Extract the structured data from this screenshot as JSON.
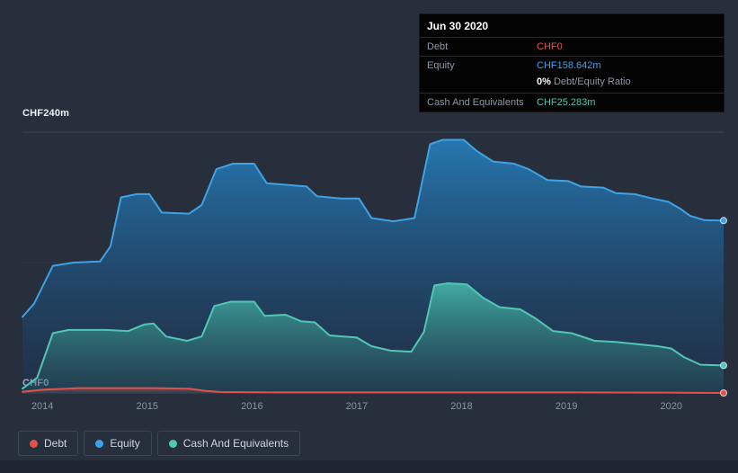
{
  "colors": {
    "background": "#272f3d",
    "grid": "#3c4554",
    "debt": "#e0524a",
    "equity": "#3ea2e5",
    "cash": "#52c6b4",
    "tooltip_background": "#040404",
    "tooltip_divider": "#2b2b2b",
    "muted_text": "#8d98a6",
    "axis_text": "#8a96a5"
  },
  "tooltip": {
    "title": "Jun 30 2020",
    "debt_label": "Debt",
    "debt_value": "CHF0",
    "equity_label": "Equity",
    "equity_value": "CHF158.642m",
    "ratio_value": "0%",
    "ratio_label": " Debt/Equity Ratio",
    "cash_label": "Cash And Equivalents",
    "cash_value": "CHF25.283m"
  },
  "axis": {
    "y_top": "CHF240m",
    "y_bottom": "CHF0"
  },
  "legend": {
    "items": [
      {
        "label": "Debt",
        "color": "#e0524a"
      },
      {
        "label": "Equity",
        "color": "#3ea2e5"
      },
      {
        "label": "Cash And Equivalents",
        "color": "#52c6b4"
      }
    ]
  },
  "chart_data": {
    "type": "area",
    "y_unit": "CHF millions",
    "x_domain": [
      2013.81,
      2020.5
    ],
    "ylim": [
      0,
      240
    ],
    "x_ticks": [
      2014,
      2015,
      2016,
      2017,
      2018,
      2019,
      2020
    ],
    "y_gridlines": [
      {
        "value": 240,
        "opacity": 1
      },
      {
        "value": 120,
        "opacity": 0.3
      },
      {
        "value": 0,
        "opacity": 1
      }
    ],
    "grid_color": "#3c4554",
    "series": [
      {
        "name": "Equity",
        "color": "#3ea2e5",
        "fill_top": "rgba(38,132,197,0.85)",
        "fill_bottom": "rgba(22,52,88,0.35)",
        "points": [
          [
            2013.81,
            70
          ],
          [
            2013.92,
            82
          ],
          [
            2014.1,
            117
          ],
          [
            2014.3,
            120
          ],
          [
            2014.55,
            121
          ],
          [
            2014.65,
            135
          ],
          [
            2014.75,
            180
          ],
          [
            2014.9,
            183
          ],
          [
            2015.02,
            183
          ],
          [
            2015.14,
            166
          ],
          [
            2015.4,
            165
          ],
          [
            2015.52,
            173
          ],
          [
            2015.66,
            206
          ],
          [
            2015.82,
            211
          ],
          [
            2016.02,
            211
          ],
          [
            2016.14,
            193
          ],
          [
            2016.4,
            191
          ],
          [
            2016.52,
            190
          ],
          [
            2016.62,
            181
          ],
          [
            2016.85,
            179
          ],
          [
            2017.02,
            179
          ],
          [
            2017.14,
            161
          ],
          [
            2017.35,
            158
          ],
          [
            2017.55,
            161
          ],
          [
            2017.7,
            229
          ],
          [
            2017.82,
            233
          ],
          [
            2018.02,
            233
          ],
          [
            2018.14,
            223
          ],
          [
            2018.3,
            213
          ],
          [
            2018.5,
            211
          ],
          [
            2018.64,
            206
          ],
          [
            2018.82,
            196
          ],
          [
            2019.02,
            195
          ],
          [
            2019.14,
            190
          ],
          [
            2019.35,
            189
          ],
          [
            2019.47,
            184
          ],
          [
            2019.65,
            183
          ],
          [
            2019.82,
            179
          ],
          [
            2019.97,
            176
          ],
          [
            2020.08,
            170
          ],
          [
            2020.18,
            163
          ],
          [
            2020.32,
            159
          ],
          [
            2020.5,
            158.642
          ]
        ]
      },
      {
        "name": "Cash And Equivalents",
        "color": "#52c6b4",
        "fill_top": "rgba(74,196,176,0.8)",
        "fill_bottom": "rgba(34,84,94,0.35)",
        "points": [
          [
            2013.81,
            4
          ],
          [
            2013.95,
            14
          ],
          [
            2014.1,
            55
          ],
          [
            2014.25,
            58
          ],
          [
            2014.6,
            58
          ],
          [
            2014.82,
            57
          ],
          [
            2014.97,
            63
          ],
          [
            2015.06,
            64
          ],
          [
            2015.18,
            52
          ],
          [
            2015.38,
            48
          ],
          [
            2015.52,
            52
          ],
          [
            2015.64,
            80
          ],
          [
            2015.8,
            84
          ],
          [
            2016.02,
            84
          ],
          [
            2016.12,
            71
          ],
          [
            2016.32,
            72
          ],
          [
            2016.47,
            66
          ],
          [
            2016.6,
            65
          ],
          [
            2016.74,
            53
          ],
          [
            2017.0,
            51
          ],
          [
            2017.14,
            43
          ],
          [
            2017.32,
            39
          ],
          [
            2017.52,
            38
          ],
          [
            2017.64,
            56
          ],
          [
            2017.74,
            99
          ],
          [
            2017.87,
            101
          ],
          [
            2018.05,
            100
          ],
          [
            2018.2,
            88
          ],
          [
            2018.36,
            79
          ],
          [
            2018.56,
            77
          ],
          [
            2018.7,
            69
          ],
          [
            2018.87,
            57
          ],
          [
            2019.05,
            55
          ],
          [
            2019.27,
            48
          ],
          [
            2019.47,
            47
          ],
          [
            2019.67,
            45
          ],
          [
            2019.87,
            43
          ],
          [
            2020.0,
            41
          ],
          [
            2020.12,
            33
          ],
          [
            2020.28,
            26
          ],
          [
            2020.5,
            25.283
          ]
        ]
      },
      {
        "name": "Debt",
        "color": "#e0524a",
        "fill_top": "rgba(224,82,74,0.45)",
        "fill_bottom": "rgba(224,82,74,0.05)",
        "points": [
          [
            2013.81,
            1
          ],
          [
            2014.0,
            3
          ],
          [
            2014.35,
            4.5
          ],
          [
            2015.05,
            4.5
          ],
          [
            2015.4,
            4
          ],
          [
            2015.55,
            2
          ],
          [
            2015.7,
            0.8
          ],
          [
            2016.2,
            0.5
          ],
          [
            2017.0,
            0.5
          ],
          [
            2018.0,
            0.5
          ],
          [
            2019.0,
            0.5
          ],
          [
            2020.0,
            0.3
          ],
          [
            2020.5,
            0
          ]
        ]
      }
    ]
  }
}
